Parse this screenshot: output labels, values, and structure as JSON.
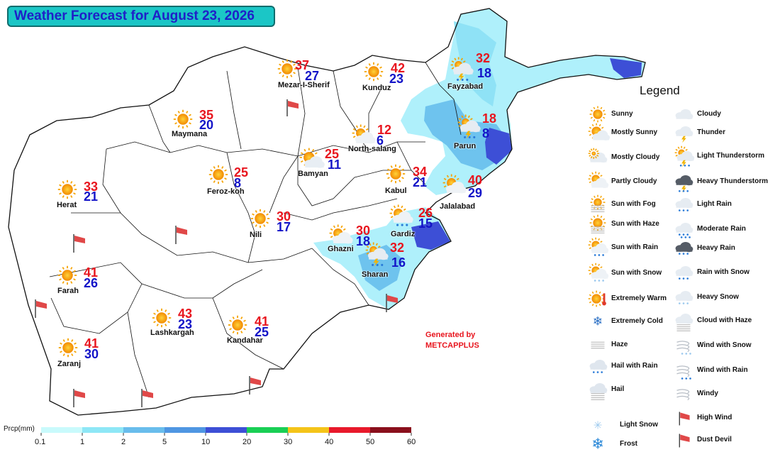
{
  "title": "Weather Forecast for August 23, 2026",
  "cities": [
    {
      "name": "Mezar-I-Sherif",
      "max": "37",
      "min": "27",
      "icon": "sunny-icon"
    },
    {
      "name": "Kunduz",
      "max": "42",
      "min": "23",
      "icon": "sunny-icon"
    },
    {
      "name": "Fayzabad",
      "max": "32",
      "min": "18",
      "icon": "light-thunderstorm-icon"
    },
    {
      "name": "Maymana",
      "max": "35",
      "min": "20",
      "icon": "sunny-icon"
    },
    {
      "name": "North-salang",
      "max": "12",
      "min": "6",
      "icon": "partly-cloudy-icon"
    },
    {
      "name": "Parun",
      "max": "18",
      "min": "8",
      "icon": "light-thunderstorm-icon"
    },
    {
      "name": "Bamyan",
      "max": "25",
      "min": "11",
      "icon": "mostly-sunny-icon"
    },
    {
      "name": "Feroz-koh",
      "max": "25",
      "min": "8",
      "icon": "sunny-icon"
    },
    {
      "name": "Kabul",
      "max": "34",
      "min": "21",
      "icon": "sunny-icon"
    },
    {
      "name": "Herat",
      "max": "33",
      "min": "21",
      "icon": "sunny-icon"
    },
    {
      "name": "Jalalabad",
      "max": "40",
      "min": "29",
      "icon": "partly-cloudy-icon"
    },
    {
      "name": "Nili",
      "max": "30",
      "min": "17",
      "icon": "sunny-icon"
    },
    {
      "name": "Gardiz",
      "max": "26",
      "min": "15",
      "icon": "sun-with-rain-icon"
    },
    {
      "name": "Ghazni",
      "max": "30",
      "min": "18",
      "icon": "partly-cloudy-icon"
    },
    {
      "name": "Sharan",
      "max": "32",
      "min": "16",
      "icon": "light-thunderstorm-icon"
    },
    {
      "name": "Farah",
      "max": "41",
      "min": "26",
      "icon": "sunny-icon"
    },
    {
      "name": "Lashkargah",
      "max": "43",
      "min": "23",
      "icon": "sunny-icon"
    },
    {
      "name": "Kandahar",
      "max": "41",
      "min": "25",
      "icon": "sunny-icon"
    },
    {
      "name": "Zaranj",
      "max": "41",
      "min": "30",
      "icon": "sunny-icon"
    }
  ],
  "legend": {
    "title": "Legend",
    "items": [
      "Sunny",
      "Mostly Sunny",
      "Mostly Cloudy",
      "Partly Cloudy",
      "Sun with Fog",
      "Sun with Haze",
      "Sun with Rain",
      "Sun with Snow",
      "Extremely Warm",
      "Extremely Cold",
      "Haze",
      "Hail with Rain",
      "Hail",
      "Light Snow",
      "Frost",
      "Cloudy",
      "Thunder",
      "Light Thunderstorm",
      "Heavy Thunderstorm",
      "Light Rain",
      "Moderate Rain",
      "Heavy Rain",
      "Rain with Snow",
      "Heavy Snow",
      "Cloud with Haze",
      "Wind with Snow",
      "Wind with Rain",
      "Windy",
      "High Wind",
      "Dust Devil"
    ]
  },
  "credit": {
    "line1": "Generated by",
    "line2": "METCAPPLUS"
  },
  "colorbar": {
    "label": "Prcp(mm)",
    "ticks": [
      "0.1",
      "1",
      "2",
      "5",
      "10",
      "20",
      "30",
      "40",
      "50",
      "60"
    ],
    "colors": [
      "#c9fafc",
      "#8ee7f6",
      "#69bdec",
      "#4f96e2",
      "#3d4fd6",
      "#19cf55",
      "#f4c419",
      "#e8192b",
      "#8a0f1c"
    ]
  },
  "colors": {
    "max_temp": "#e8151e",
    "min_temp": "#1414c8",
    "title_bg": "#1bc6c6"
  }
}
